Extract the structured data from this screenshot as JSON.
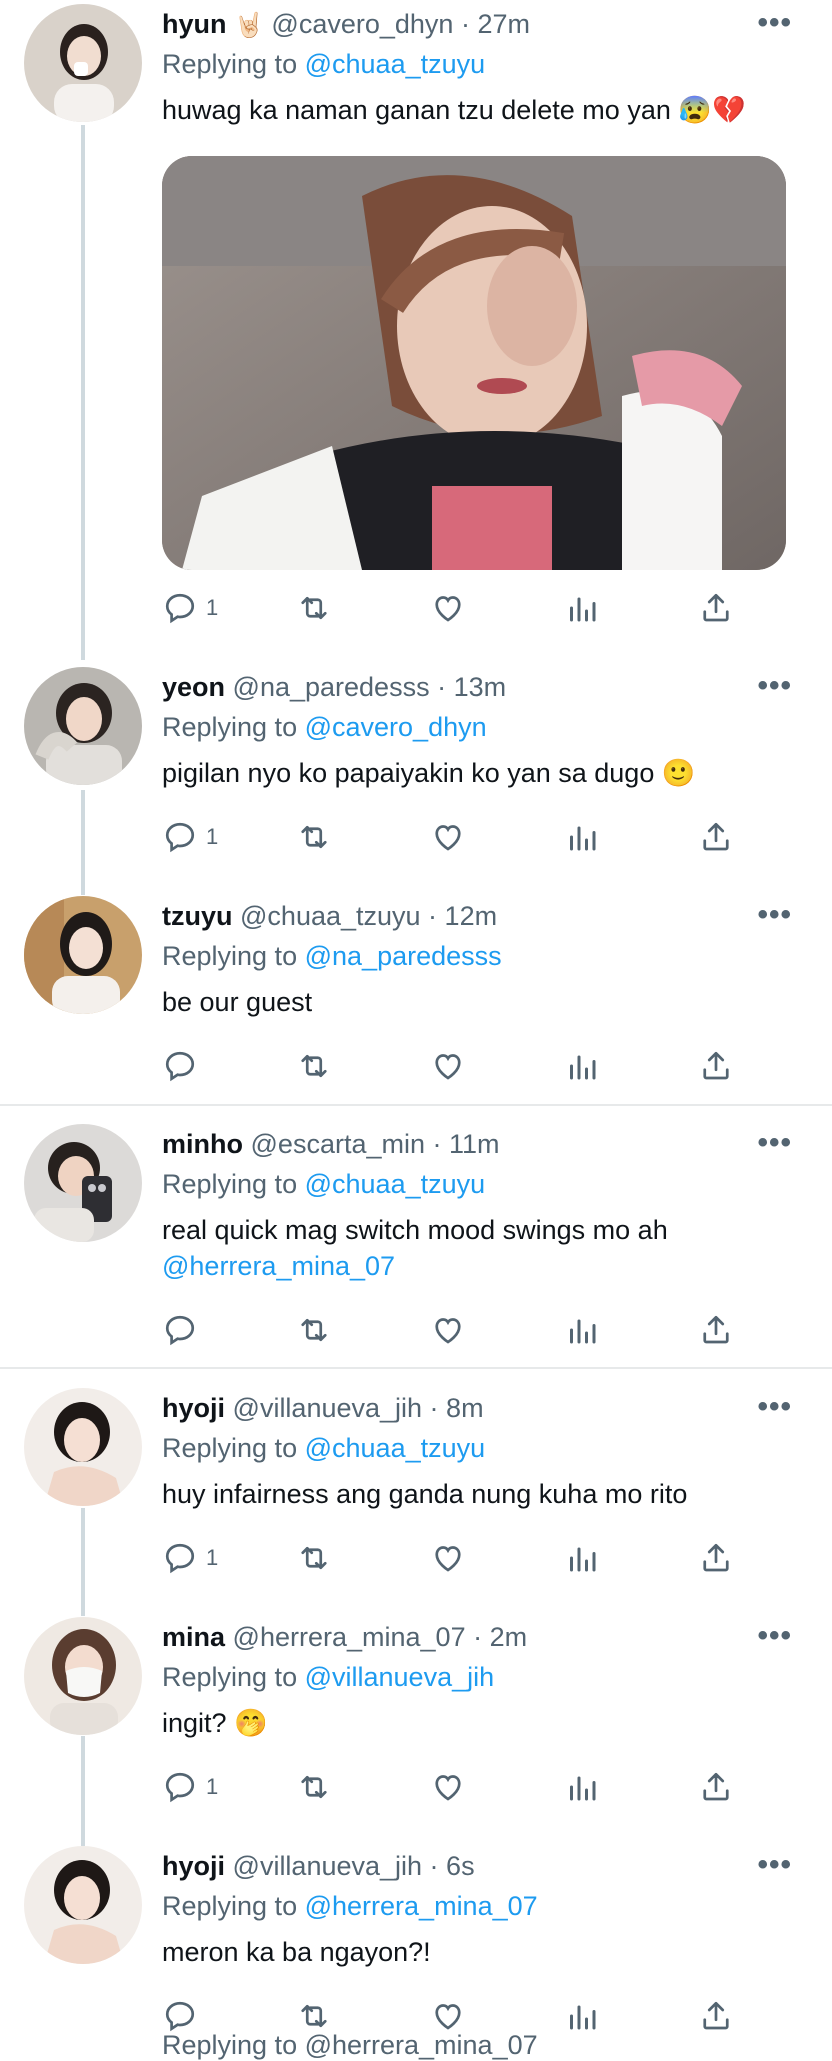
{
  "tweets": [
    {
      "name": "hyun",
      "badge": "🤘🏻",
      "handle": "@cavero_dhyn",
      "time": "27m",
      "replying_prefix": "Replying to",
      "replying_to": "@chuaa_tzuyu",
      "text": "huwag ka naman ganan tzu delete mo yan",
      "emoji_tail": "😰💔",
      "replies": "1"
    },
    {
      "name": "yeon",
      "handle": "@na_paredesss",
      "time": "13m",
      "replying_prefix": "Replying to",
      "replying_to": "@cavero_dhyn",
      "text": "pigilan nyo ko papaiyakin ko yan sa dugo",
      "emoji_tail": "🙂",
      "replies": "1"
    },
    {
      "name": "tzuyu",
      "handle": "@chuaa_tzuyu",
      "time": "12m",
      "replying_prefix": "Replying to",
      "replying_to": "@na_paredesss",
      "text": "be our guest",
      "replies": ""
    },
    {
      "name": "minho",
      "handle": "@escarta_min",
      "time": "11m",
      "replying_prefix": "Replying to",
      "replying_to": "@chuaa_tzuyu",
      "text": "real quick mag switch mood swings mo ah",
      "mention_line": "@herrera_mina_07",
      "replies": ""
    },
    {
      "name": "hyoji",
      "handle": "@villanueva_jih",
      "time": "8m",
      "replying_prefix": "Replying to",
      "replying_to": "@chuaa_tzuyu",
      "text": "huy infairness ang ganda nung kuha mo rito",
      "replies": "1"
    },
    {
      "name": "mina",
      "handle": "@herrera_mina_07",
      "time": "2m",
      "replying_prefix": "Replying to",
      "replying_to": "@villanueva_jih",
      "text": "ingit?",
      "emoji_tail": "🤭",
      "replies": "1"
    },
    {
      "name": "hyoji",
      "handle": "@villanueva_jih",
      "time": "6s",
      "replying_prefix": "Replying to",
      "replying_to": "@herrera_mina_07",
      "text": "meron ka ba ngayon?!",
      "replies": ""
    }
  ],
  "more_label": "•••",
  "cut_off_text": "Replying to @herrera_mina_07",
  "colors": {
    "accent": "#1d9bf0",
    "secondary": "#536471",
    "divider": "#e7e9ea"
  }
}
